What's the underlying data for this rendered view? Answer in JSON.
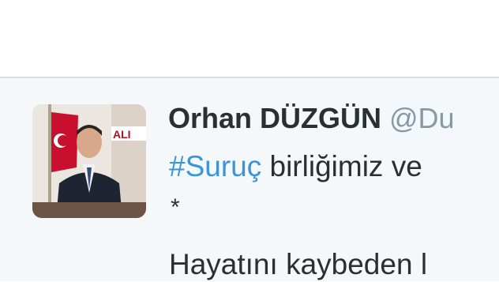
{
  "tweet": {
    "author_name": "Orhan DÜZGÜN",
    "author_handle": "@Du",
    "hashtag": "#Suruç",
    "line1_rest": " birliğimiz ve",
    "line2": "*",
    "line3": "Hayatını kaybeden l",
    "avatar_icon": "profile-photo-icon"
  },
  "colors": {
    "hashtag": "#3b94d9",
    "name": "#292f33",
    "handle": "#8899a6",
    "card_background": "#f5f8fa",
    "border": "#d6dde3"
  }
}
